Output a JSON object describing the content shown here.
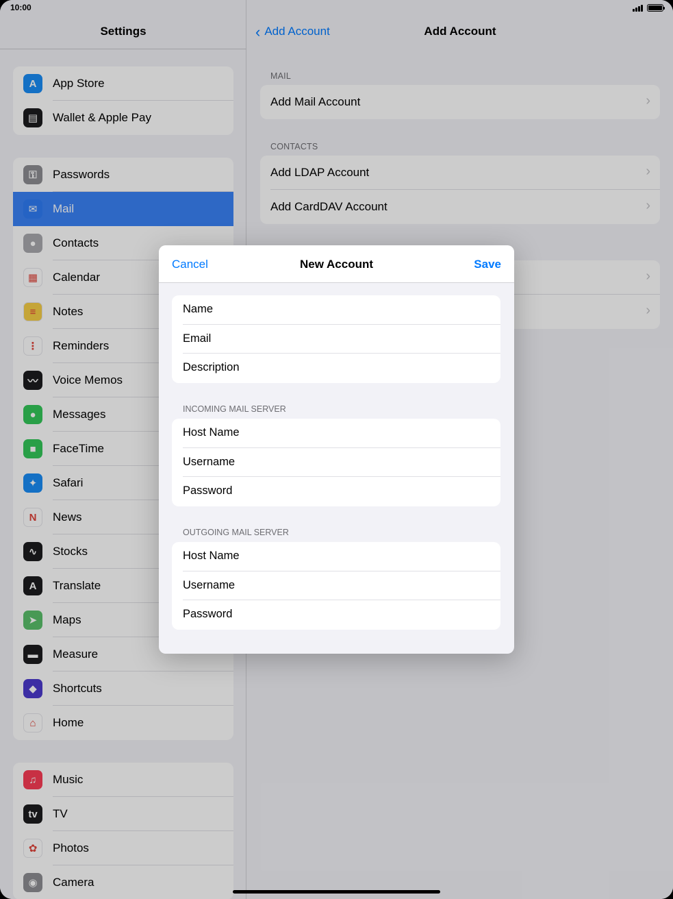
{
  "status_bar": {
    "time": "10:00"
  },
  "sidebar": {
    "title": "Settings",
    "groups": [
      {
        "items": [
          {
            "label": "App Store",
            "icon": "app-store-icon",
            "color": "#1a8cf5",
            "glyph": "A"
          },
          {
            "label": "Wallet & Apple Pay",
            "icon": "wallet-icon",
            "color": "#1c1c1e",
            "glyph": "▤"
          }
        ]
      },
      {
        "items": [
          {
            "label": "Passwords",
            "icon": "key-icon",
            "color": "#8e8e93",
            "glyph": "⚿"
          },
          {
            "label": "Mail",
            "icon": "mail-icon",
            "color": "#2f7cf6",
            "glyph": "✉",
            "selected": true
          },
          {
            "label": "Contacts",
            "icon": "contacts-icon",
            "color": "#a9a9ae",
            "glyph": "●"
          },
          {
            "label": "Calendar",
            "icon": "calendar-icon",
            "color": "#ffffff",
            "glyph": "▦"
          },
          {
            "label": "Notes",
            "icon": "notes-icon",
            "color": "#f7cf46",
            "glyph": "≡"
          },
          {
            "label": "Reminders",
            "icon": "reminders-icon",
            "color": "#ffffff",
            "glyph": "⋮"
          },
          {
            "label": "Voice Memos",
            "icon": "voice-memos-icon",
            "color": "#1c1c1e",
            "glyph": "〰"
          },
          {
            "label": "Messages",
            "icon": "messages-icon",
            "color": "#34c759",
            "glyph": "●"
          },
          {
            "label": "FaceTime",
            "icon": "facetime-icon",
            "color": "#34c759",
            "glyph": "■"
          },
          {
            "label": "Safari",
            "icon": "safari-icon",
            "color": "#1a8cf5",
            "glyph": "✦"
          },
          {
            "label": "News",
            "icon": "news-icon",
            "color": "#ffffff",
            "glyph": "N"
          },
          {
            "label": "Stocks",
            "icon": "stocks-icon",
            "color": "#1c1c1e",
            "glyph": "∿"
          },
          {
            "label": "Translate",
            "icon": "translate-icon",
            "color": "#1c1c1e",
            "glyph": "A"
          },
          {
            "label": "Maps",
            "icon": "maps-icon",
            "color": "#5ac06b",
            "glyph": "➤"
          },
          {
            "label": "Measure",
            "icon": "measure-icon",
            "color": "#1c1c1e",
            "glyph": "▬"
          },
          {
            "label": "Shortcuts",
            "icon": "shortcuts-icon",
            "color": "#4b3acd",
            "glyph": "◆"
          },
          {
            "label": "Home",
            "icon": "home-icon",
            "color": "#ffffff",
            "glyph": "⌂"
          }
        ]
      },
      {
        "items": [
          {
            "label": "Music",
            "icon": "music-icon",
            "color": "#fa3c55",
            "glyph": "♫"
          },
          {
            "label": "TV",
            "icon": "tv-icon",
            "color": "#1c1c1e",
            "glyph": "tv"
          },
          {
            "label": "Photos",
            "icon": "photos-icon",
            "color": "#ffffff",
            "glyph": "✿"
          },
          {
            "label": "Camera",
            "icon": "camera-icon",
            "color": "#8e8e93",
            "glyph": "◉"
          }
        ]
      }
    ]
  },
  "main": {
    "back_label": "Add Account",
    "title": "Add Account",
    "sections": [
      {
        "header": "MAIL",
        "rows": [
          "Add Mail Account"
        ]
      },
      {
        "header": "CONTACTS",
        "rows": [
          "Add LDAP Account",
          "Add CardDAV Account"
        ]
      },
      {
        "header": "",
        "rows": [
          "",
          ""
        ]
      }
    ]
  },
  "modal": {
    "cancel_label": "Cancel",
    "title": "New Account",
    "save_label": "Save",
    "account_fields": [
      "Name",
      "Email",
      "Description"
    ],
    "incoming_header": "INCOMING MAIL SERVER",
    "incoming_fields": [
      "Host Name",
      "Username",
      "Password"
    ],
    "outgoing_header": "OUTGOING MAIL SERVER",
    "outgoing_fields": [
      "Host Name",
      "Username",
      "Password"
    ]
  }
}
